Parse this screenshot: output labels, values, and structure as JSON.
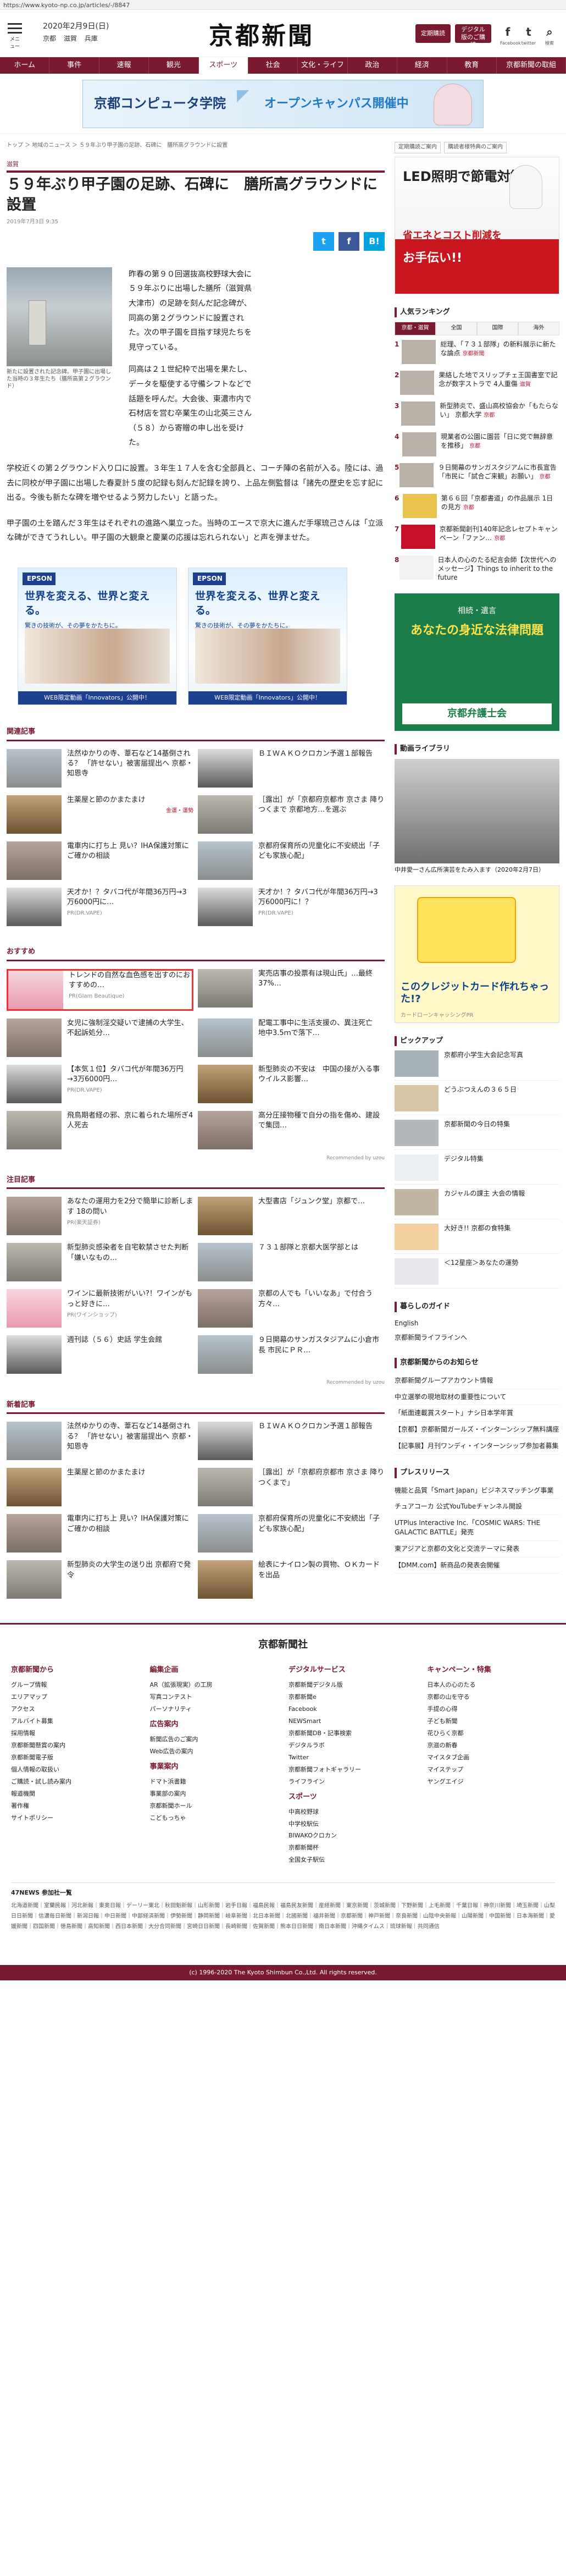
{
  "url": "https://www.kyoto-np.co.jp/articles/-/8847",
  "header": {
    "menu_label": "メニュー",
    "date": "2020年2月9日(日)",
    "weather": [
      "京都",
      "滋賀",
      "兵庫"
    ],
    "logo": "京都新聞",
    "btn_subscribe": "定期購読",
    "btn_digital": "デジタル版のご購読",
    "social": [
      {
        "icon": "facebook-icon",
        "glyph": "f",
        "label": "Facebook"
      },
      {
        "icon": "twitter-icon",
        "glyph": "t",
        "label": "twitter"
      },
      {
        "icon": "search-icon",
        "glyph": "⌕",
        "label": "検索"
      }
    ]
  },
  "nav": [
    "ホーム",
    "事件",
    "速報",
    "観光",
    "スポーツ",
    "社会",
    "文化・ライフ",
    "政治",
    "経済",
    "教育",
    "京都新聞の取組"
  ],
  "top_ad": {
    "name": "京都コンピュータ学院",
    "copy": "オープンキャンパス開催中"
  },
  "breadcrumb": "トップ ＞ 地域のニュース ＞ ５９年ぶり甲子園の足跡、石碑に　膳所高グラウンドに設置",
  "article": {
    "category": "滋賀",
    "title": "５９年ぶり甲子園の足跡、石碑に　膳所高グラウンドに設置",
    "published": "2019年7月3日 9:35",
    "share": [
      {
        "icon": "twitter-icon",
        "label": "t",
        "color": "#1da1f2"
      },
      {
        "icon": "facebook-icon",
        "label": "f",
        "color": "#3b5998"
      },
      {
        "icon": "hatena-icon",
        "label": "B!",
        "color": "#00a4de"
      }
    ],
    "photo_caption": "新たに設置された記念碑。甲子園に出場した当時の３年生たち（膳所高第２グラウンド）",
    "lead": "昨春の第９０回選抜高校野球大会に５９年ぶりに出場した膳所（滋賀県大津市）の足跡を刻んだ記念碑が、同高の第２グラウンドに設置された。次の甲子園を目指す球児たちを見守っている。",
    "lead2": "同高は２１世紀枠で出場を果たし、データを駆使する守備シフトなどで話題を呼んだ。大会後、東濃市内で石材店を営む卒業生の山北英三さん（５８）から寄贈の申し出を受けた。",
    "p2": "学校近くの第２グラウンド入り口に設置。３年生１７人を含む全部員と、コーチ陣の名前が入る。陸には、過去に同校が甲子園に出場した春夏計５度の記録も刻んだ記録を誇り、上品左側監督は「諸先の歴史を忘す記に出る。今後も新たな碑を増やせるよう努力したい」と語った。",
    "p3": "甲子園の土を踏んだ３年生はそれぞれの進路へ巣立った。当時のエースで京大に進んだ手塚琉己さんは「立派な碑ができてうれしい。甲子園の大観衆と慶業の応援は忘れられない」と声を弾ませた。"
  },
  "epson_ads": [
    {
      "brand": "EPSON",
      "head": "世界を変える、世界と変える。",
      "sub": "驚きの技術が、その夢をかたちに。",
      "foot": "WEB限定動画「Innovators」公開中！"
    },
    {
      "brand": "EPSON",
      "head": "世界を変える、世界と変える。",
      "sub": "驚きの技術が、その夢をかたちに。",
      "foot": "WEB限定動画「Innovators」公開中！"
    }
  ],
  "related": {
    "heading": "関連記事",
    "items": [
      {
        "title": "法然ゆかりの寺、葦石など14基倒される？ 「許せない」被害届提出へ 京都・知恩寺",
        "meta": ""
      },
      {
        "title": "ＢＩＷＡＫＯクロカン予選１部報告",
        "meta": ""
      },
      {
        "title": "生薬屋と節のかまたまけ",
        "meta": "金運・運勢"
      },
      {
        "title": "［露出］が「京都府京都市 京さま 降りつくまで 京都地方…を選ぶ",
        "meta": ""
      },
      {
        "title": "電車内に打ち上 見い？IHA保護対策にご確かの相談",
        "meta": ""
      },
      {
        "title": "京都府保育所の児童化に不安続出「子ども家族心配」",
        "meta": ""
      },
      {
        "title": "天才か！？タバコ代が年間36万円→3万6000円に…",
        "meta": "PR(DR.VAPE)"
      },
      {
        "title": "天才か！？タバコ代が年間36万円→3万6000円に！？",
        "meta": "PR(DR.VAPE)"
      }
    ]
  },
  "recommend": {
    "heading": "おすすめ",
    "items": [
      {
        "title": "トレンドの自然な血色感を出すのにおすすめの…",
        "meta": "PR(Glam Beautique)"
      },
      {
        "title": "実売店事の投票有は現山氏」…最終37%…",
        "meta": ""
      },
      {
        "title": "女児に強制淫交疑いで逮捕の大学生、不起訴処分…",
        "meta": ""
      },
      {
        "title": "配電工事中に生活支援の、異注死亡　地中3.5ｍで落下…",
        "meta": ""
      },
      {
        "title": "【本気１位】タバコ代が年間36万円→3万6000円…",
        "meta": "PR(DR.VAPE)"
      },
      {
        "title": "新型肺炎の不安は　中国の接が入る事　ウイルス影響…",
        "meta": ""
      },
      {
        "title": "飛鳥期者経の邪、京に着られた場所ぎ4人死去",
        "meta": ""
      },
      {
        "title": "高分圧接物種で自分の指を傷め、建設で集団…",
        "meta": ""
      }
    ],
    "credit": "Recommended by uzou"
  },
  "popular": {
    "heading": "注目記事",
    "items": [
      {
        "title": "あなたの運用力を2分で簡単に診断します 18の問い",
        "meta": "PR(楽天証券)"
      },
      {
        "title": "大型書店「ジュンク堂」京都で…",
        "meta": ""
      },
      {
        "title": "新型肺炎感染者を自宅軟禁させた判断「嫌いなもの…",
        "meta": ""
      },
      {
        "title": "７３１部隊と京都大医学部とは",
        "meta": ""
      },
      {
        "title": "ワインに最新技術がいい?！ワインがもっと好きに…",
        "meta": "PR(ワインショップ)"
      },
      {
        "title": "京都の人でも「いいなあ」で付合う方々…",
        "meta": ""
      },
      {
        "title": "週刊誌（５６）史話 学生会館 ",
        "meta": ""
      },
      {
        "title": "９日開幕のサンガスタジアムに小倉市長 市民にＰＲ…",
        "meta": ""
      }
    ],
    "credit": "Recommended by uzou"
  },
  "latest": {
    "heading": "新着記事",
    "items": [
      {
        "title": "法然ゆかりの寺、葦石など14基倒される？ 「許せない」被害届提出へ 京都・知恩寺",
        "meta": ""
      },
      {
        "title": "ＢＩＷＡＫＯクロカン予選１部報告",
        "meta": ""
      },
      {
        "title": "生薬屋と節のかまたまけ",
        "meta": ""
      },
      {
        "title": "［露出］が「京都府京都市 京さま 降りつくまで」",
        "meta": ""
      },
      {
        "title": "電車内に打ち上 見い？IHA保護対策にご確かの相談",
        "meta": ""
      },
      {
        "title": "京都府保育所の児童化に不安続出「子ども家族心配」",
        "meta": ""
      },
      {
        "title": "新型肺炎の大学生の送り出 京都府で発令",
        "meta": ""
      },
      {
        "title": "絵表にナイロン製の買物、ＯＫカードを出品",
        "meta": ""
      }
    ]
  },
  "side": {
    "btn_backnumber": "定期購読ご案内",
    "btn_biz": "購読者様特典のご案内",
    "ad_bulb": {
      "l1": "LED照明で節電対策！",
      "l2": "省エネとコスト削減を",
      "l3": "お手伝い!!",
      "brand": "大ondo商会"
    },
    "ranking_heading": "人気ランキング",
    "ranking_tabs": [
      "京都・滋賀",
      "全国",
      "国際",
      "海外"
    ],
    "ranking": [
      {
        "n": "1",
        "t": "総理、「７３１部隊」の新料展示に新たな論点",
        "tag": "京都新聞"
      },
      {
        "n": "2",
        "t": "果絡した地でスリップチェ王国書室で記念が数字ストラで 4人重傷",
        "tag": "滋賀"
      },
      {
        "n": "3",
        "t": "新型肺炎で、盛山高校協会か「もたらない」 京都大学",
        "tag": "京都"
      },
      {
        "n": "4",
        "t": "現業者の公園に園芸「日に党で無辞意を推移」",
        "tag": "京都"
      },
      {
        "n": "5",
        "t": "９日開幕のサンガスタジアムに市長宣告「市民に「試合ご来観」お願い」",
        "tag": "京都"
      },
      {
        "n": "6",
        "t": "第６６回「京都書道」の作品展示 1日の見方",
        "tag": "京都"
      },
      {
        "n": "7",
        "t": "京都新聞創刊140年記念レセプトキャンペーン「ファン…",
        "tag": "京都"
      },
      {
        "n": "8",
        "t": "日本人の心のたる紀言会師【次世代へのメッセージ】Things to inherit to the future",
        "tag": ""
      }
    ],
    "ad_law": {
      "a": "相続・遺言",
      "b": "あなたの身近な法律問題",
      "c": "京都弁護士会"
    },
    "lib_heading": "動画ライブラリ",
    "lib_caption": "中井愛一さん広所演芸をたみ入ます（2020年2月7日）",
    "ad_card": {
      "t": "このクレジットカード作れちゃった!?",
      "f": "カードローンキャッシングPR"
    },
    "pickup_heading": "ピックアップ",
    "pickup": [
      {
        "t": "京都府小学生大会記念写真"
      },
      {
        "t": "どうぶつえんの３６５日"
      },
      {
        "t": "京都新聞の今日の特集"
      },
      {
        "t": "デジタル特集"
      },
      {
        "t": "カジャルの課主 大会の情報"
      },
      {
        "t": "大好き!! 京都の食特集"
      },
      {
        "t": "＜12星座＞あなたの運勢"
      }
    ],
    "guide_heading": "暮らしのガイド",
    "guide": [
      "English",
      "京都新聞ライフラインへ"
    ],
    "news_heading": "京都新聞からのお知らせ",
    "news": [
      "京都新聞グループアカウント情報",
      "中立選挙の現地取材の重要性について",
      "「紙面連載賞スタート」ナシ日本学年賞",
      "【京都】京都新聞ガールズ・インターンシップ無料講座",
      "【記事展】月刊ワンディ・インターンシップ参加者募集"
    ],
    "press_heading": "プレスリリース",
    "press": [
      "機能と品質「Smart Japan」ビジネスマッチング事業",
      "チュアコーカ 公式YouTubeチャンネル開設",
      "UTPlus Interactive Inc.「COSMIC WARS: THE GALACTIC BATTLE」発売",
      "東アジアと京都の文化と交流テーマに発表",
      "【DMM.com】新商品の発表会開催"
    ]
  },
  "footer": {
    "logo": "京都新聞社",
    "cols": [
      {
        "h": "京都新聞から",
        "items": [
          "グループ情報",
          "エリアマップ",
          "アクセス",
          "アルバイト募集",
          "採用情報",
          "京都新聞懸賞の案内",
          "京都新聞電子版",
          "個人情報の取扱い",
          "ご購読・試し読み案内",
          "報道機関",
          "著作権",
          "サイトポリシー"
        ]
      },
      {
        "h": "編集企画",
        "items": [
          "AR（拡張現実）の工房",
          "写真コンテスト",
          "パーソナリティ"
        ],
        "sub": "広告案内",
        "sub_items": [
          "新聞広告のご案内",
          "Web広告の案内"
        ],
        "sub2": "事業案内",
        "sub2_items": [
          "ドマト浜書籍",
          "事業部の案内",
          "京都新聞ホール",
          "こどもっちゃ"
        ]
      },
      {
        "h": "デジタルサービス",
        "items": [
          "京都新聞デジタル版",
          "京都新聞e",
          "Facebook",
          "NEWSmart",
          "京都新聞DB・記事検索",
          "デジタルラボ",
          "Twitter",
          "京都新聞フォトギャラリー",
          "ライフライン"
        ],
        "sub": "スポーツ",
        "sub_items": [
          "中高校野球",
          "中学校駅伝",
          "BIWAKOクロカン",
          "京都新聞杯",
          "全国女子駅伝"
        ]
      },
      {
        "h": "キャンペーン・特集",
        "items": [
          "日本人の心のたる",
          "京都の山を守る",
          "手提の心得",
          "子ども新聞",
          "花ひらく京都",
          "京滋の新春",
          "マイスタブ企画",
          "マイステップ",
          "ヤングエイジ"
        ]
      }
    ],
    "net_heading": "47NEWS 参加社一覧",
    "net": "北海道新聞｜室蘭民報｜河北新報｜東奥日報｜デーリー東北｜秋田魁新報｜山形新聞｜岩手日報｜福島民報｜福島民友新聞｜産経新聞｜東京新聞｜茨城新聞｜下野新聞｜上毛新聞｜千葉日報｜神奈川新聞｜埼玉新聞｜山梨日日新聞｜信濃毎日新聞｜新潟日報｜中日新聞｜中部経済新聞｜伊勢新聞｜静岡新聞｜岐阜新聞｜北日本新聞｜北國新聞｜福井新聞｜京都新聞｜神戸新聞｜奈良新聞｜山陰中央新報｜山陽新聞｜中国新聞｜日本海新聞｜愛媛新聞｜四国新聞｜徳島新聞｜高知新聞｜西日本新聞｜大分合同新聞｜宮崎日日新聞｜長崎新聞｜佐賀新聞｜熊本日日新聞｜南日本新聞｜沖縄タイムス｜琉球新報｜共同通信",
    "copyright": "(c) 1996-2020 The Kyoto Shimbun Co.,Ltd. All rights reserved."
  }
}
